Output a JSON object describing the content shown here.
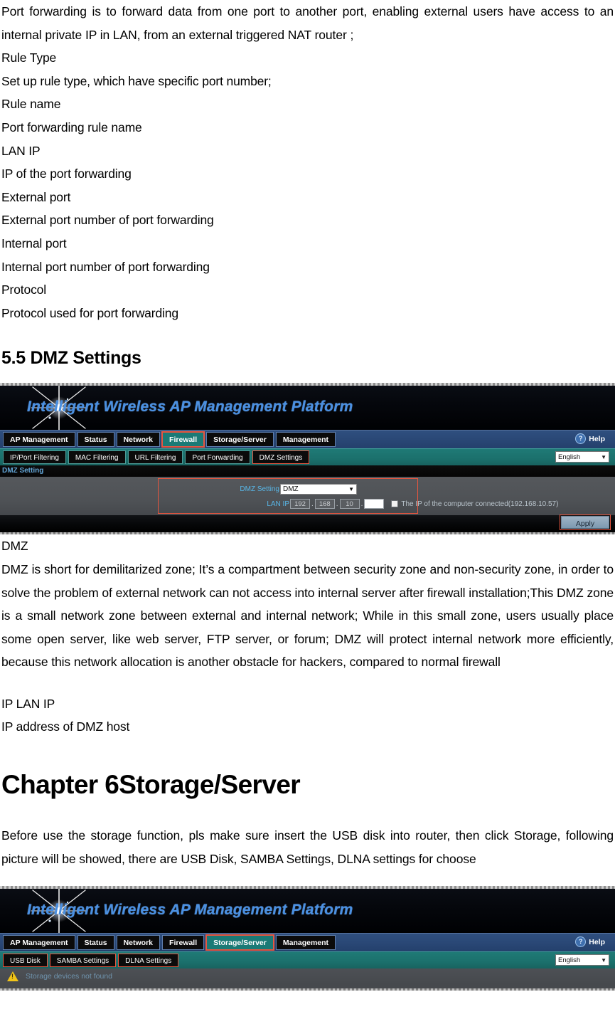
{
  "document": {
    "intro_lines": [
      "Port forwarding is to forward data from one port to another port, enabling external users have access to an internal private IP in LAN, from an external triggered NAT router ;",
      "Rule Type",
      "Set up rule type, which have specific port number;",
      "Rule name",
      "Port forwarding rule name",
      "LAN IP",
      "IP of the port forwarding",
      "External port",
      "External port number of port forwarding",
      "Internal port",
      "Internal port number of port forwarding",
      "Protocol",
      "Protocol used for port forwarding"
    ],
    "section_heading": "5.5 DMZ Settings",
    "dmz_term": "DMZ",
    "dmz_paragraph": "DMZ is short for demilitarized zone; It’s a compartment between security zone and non-security zone, in order to solve the problem of external network can not access into internal server after firewall installation;This DMZ zone is a small network zone between external and internal network; While in this small zone, users usually place some open server, like web server, FTP server, or forum; DMZ will protect internal network more efficiently, because this network allocation is another obstacle for hackers, compared to normal firewall",
    "ip_lan_ip_label": "IP LAN IP",
    "ip_lan_ip_desc": "IP address of DMZ host",
    "chapter_heading": "Chapter 6Storage/Server",
    "storage_paragraph": "Before use the storage function, pls make sure insert the USB disk into router, then click Storage, following picture will be showed, there are USB Disk, SAMBA Settings, DLNA settings for choose"
  },
  "screenshot_dmz": {
    "banner_title": "Intelligent Wireless AP Management Platform",
    "main_tabs": [
      {
        "label": "AP Management",
        "active": false
      },
      {
        "label": "Status",
        "active": false
      },
      {
        "label": "Network",
        "active": false
      },
      {
        "label": "Firewall",
        "active": true
      },
      {
        "label": "Storage/Server",
        "active": false
      },
      {
        "label": "Management",
        "active": false
      }
    ],
    "help_label": "Help",
    "help_icon": "question-mark-circle-icon",
    "sub_tabs": [
      {
        "label": "IP/Port Filtering",
        "active": false
      },
      {
        "label": "MAC Filtering",
        "active": false
      },
      {
        "label": "URL Filtering",
        "active": false
      },
      {
        "label": "Port Forwarding",
        "active": false
      },
      {
        "label": "DMZ Settings",
        "active": true
      }
    ],
    "language": {
      "value": "English",
      "options": [
        "English"
      ]
    },
    "section_label": "DMZ Setting",
    "form": {
      "dmz_setting_label": "DMZ Setting",
      "dmz_setting_value": "DMZ",
      "dmz_setting_options": [
        "DMZ"
      ],
      "lan_ip_label": "LAN IP",
      "lan_ip_octets": [
        "192",
        "168",
        "10",
        ""
      ],
      "checkbox_label": "The IP of the computer connected(192.168.10.57)",
      "checkbox_checked": false
    },
    "apply_label": "Apply"
  },
  "screenshot_storage": {
    "banner_title": "Intelligent Wireless AP Management Platform",
    "main_tabs": [
      {
        "label": "AP Management",
        "active": false
      },
      {
        "label": "Status",
        "active": false
      },
      {
        "label": "Network",
        "active": false
      },
      {
        "label": "Firewall",
        "active": false
      },
      {
        "label": "Storage/Server",
        "active": true
      },
      {
        "label": "Management",
        "active": false
      }
    ],
    "help_label": "Help",
    "help_icon": "question-mark-circle-icon",
    "sub_tabs": [
      {
        "label": "USB Disk",
        "active": true
      },
      {
        "label": "SAMBA Settings",
        "active": true
      },
      {
        "label": "DLNA Settings",
        "active": true
      }
    ],
    "language": {
      "value": "English",
      "options": [
        "English"
      ]
    },
    "status_message": "Storage devices not found",
    "status_icon": "warning-triangle-icon"
  },
  "colors": {
    "accent_blue": "#4a90e2",
    "tab_active_teal": "#1b7a76",
    "highlight_red": "#e8563f",
    "label_cyan": "#58b7e8",
    "warning_yellow": "#f0c419"
  }
}
